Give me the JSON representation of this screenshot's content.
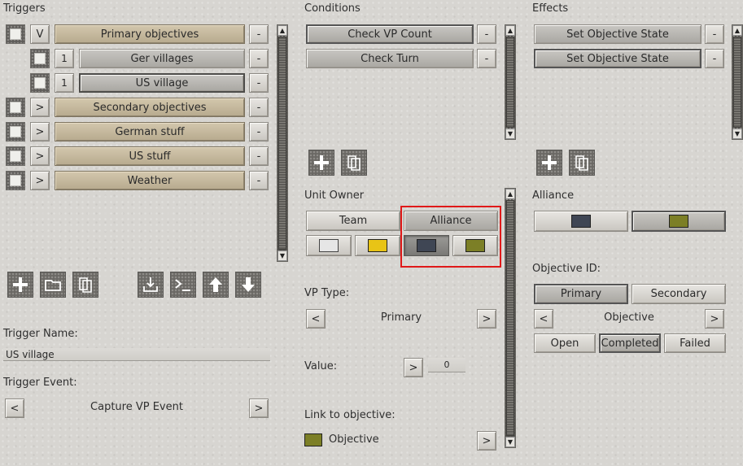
{
  "triggers": {
    "heading": "Triggers",
    "rows": [
      {
        "toggle": "V",
        "label": "Primary objectives"
      },
      {
        "toggle": "1",
        "label": "Ger villages"
      },
      {
        "toggle": "1",
        "label": "US village"
      },
      {
        "toggle": ">",
        "label": "Secondary objectives"
      },
      {
        "toggle": ">",
        "label": "German stuff"
      },
      {
        "toggle": ">",
        "label": "US stuff"
      },
      {
        "toggle": ">",
        "label": "Weather"
      }
    ],
    "remove_label": "-",
    "toolbar_icons": [
      "plus-icon",
      "folder-icon",
      "copy-icon",
      "import-icon",
      "console-icon",
      "arrow-up-icon",
      "arrow-down-icon"
    ]
  },
  "trigger_name": {
    "label": "Trigger Name:",
    "value": "US village"
  },
  "trigger_event": {
    "label": "Trigger Event:",
    "value": "Capture VP Event",
    "prev": "<",
    "next": ">"
  },
  "conditions": {
    "heading": "Conditions",
    "rows": [
      {
        "label": "Check VP Count"
      },
      {
        "label": "Check Turn"
      }
    ],
    "remove_label": "-"
  },
  "unit_owner": {
    "label": "Unit Owner",
    "tabs": [
      "Team",
      "Alliance"
    ],
    "selected_tab": "Alliance",
    "colors": [
      "#e6e6e6",
      "#e8c416",
      "#3f4654",
      "#7c7f26"
    ],
    "selected_color": "#3f4654"
  },
  "vp_type": {
    "label": "VP Type:",
    "value": "Primary",
    "prev": "<",
    "next": ">"
  },
  "value_field": {
    "label": "Value:",
    "button": ">",
    "value": "0"
  },
  "link_objective": {
    "label": "Link to objective:",
    "value": "Objective",
    "color": "#7c7f26",
    "next": ">"
  },
  "effects": {
    "heading": "Effects",
    "rows": [
      {
        "label": "Set Objective State"
      },
      {
        "label": "Set Objective State"
      }
    ],
    "remove_label": "-"
  },
  "alliance": {
    "label": "Alliance",
    "colors": [
      "#3f4654",
      "#7c7f26"
    ]
  },
  "objective_id": {
    "label": "Objective ID:",
    "tabs": [
      "Primary",
      "Secondary"
    ],
    "selected_tab": "Primary",
    "value": "Objective",
    "prev": "<",
    "next": ">",
    "states": [
      "Open",
      "Completed",
      "Failed"
    ],
    "selected_state": "Completed"
  },
  "scroll_arrows": {
    "up": "▲",
    "down": "▼"
  }
}
